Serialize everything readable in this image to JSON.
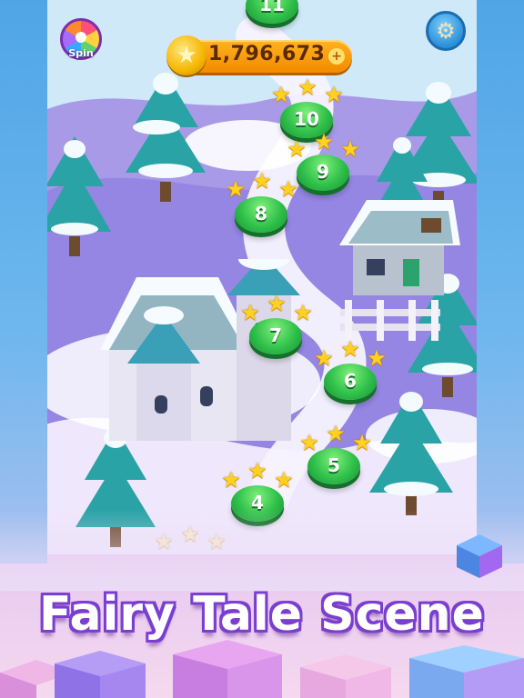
{
  "hud": {
    "coins": "1,796,673",
    "spin_label": "Spin"
  },
  "levels": [
    {
      "number": "11",
      "stars": 0
    },
    {
      "number": "10",
      "stars": 3
    },
    {
      "number": "9",
      "stars": 3
    },
    {
      "number": "8",
      "stars": 3
    },
    {
      "number": "7",
      "stars": 3
    },
    {
      "number": "6",
      "stars": 3
    },
    {
      "number": "5",
      "stars": 3
    },
    {
      "number": "4",
      "stars": 3
    }
  ],
  "banner": {
    "headline": "Fairy Tale Scene"
  },
  "colors": {
    "node_green": "#2fc04a",
    "star_gold": "#ffd21f",
    "coin_orange": "#f28a00",
    "headline_outline": "#7a3fd0"
  },
  "icons": [
    "spin-wheel-icon",
    "coin-star-icon",
    "gear-icon",
    "star-icon"
  ]
}
